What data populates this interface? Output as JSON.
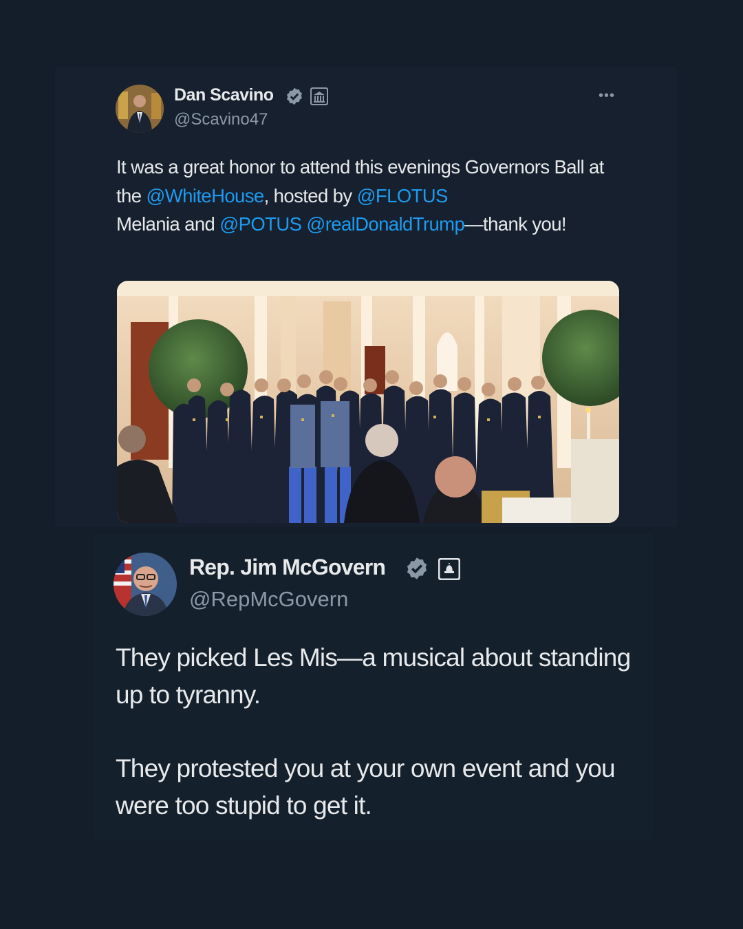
{
  "tweets": [
    {
      "author": "Dan Scavino",
      "handle": "@Scavino47",
      "verified_icon": "verified-badge-icon",
      "affiliation_icon": "white-house-affiliation-icon",
      "more_icon": "•••",
      "text_segments": [
        {
          "text": "It was a great honor to attend this evenings Governors Ball at the ",
          "mention": false
        },
        {
          "text": "@WhiteHouse",
          "mention": true
        },
        {
          "text": ", hosted by ",
          "mention": false
        },
        {
          "text": "@FLOTUS",
          "mention": true
        },
        {
          "text": " Melania and ",
          "mention": false
        },
        {
          "text": "@POTUS",
          "mention": true
        },
        {
          "text": " ",
          "mention": false
        },
        {
          "text": "@realDonaldTrump",
          "mention": true
        },
        {
          "text": "—thank you!",
          "mention": false
        }
      ],
      "media": "photo of a uniformed choir singing in an ornate white ballroom"
    },
    {
      "author": "Rep. Jim McGovern",
      "handle": "@RepMcGovern",
      "verified_icon": "verified-badge-icon",
      "affiliation_icon": "capitol-affiliation-icon",
      "paragraphs": [
        "They picked Les Mis—a musical about standing up to tyranny.",
        "They protested you at your own event and you were too stupid to get it."
      ]
    }
  ],
  "colors": {
    "background": "#141d2a",
    "mention": "#1d9bf0",
    "text": "#e7e9ea",
    "secondary_text": "#8b98a5"
  }
}
